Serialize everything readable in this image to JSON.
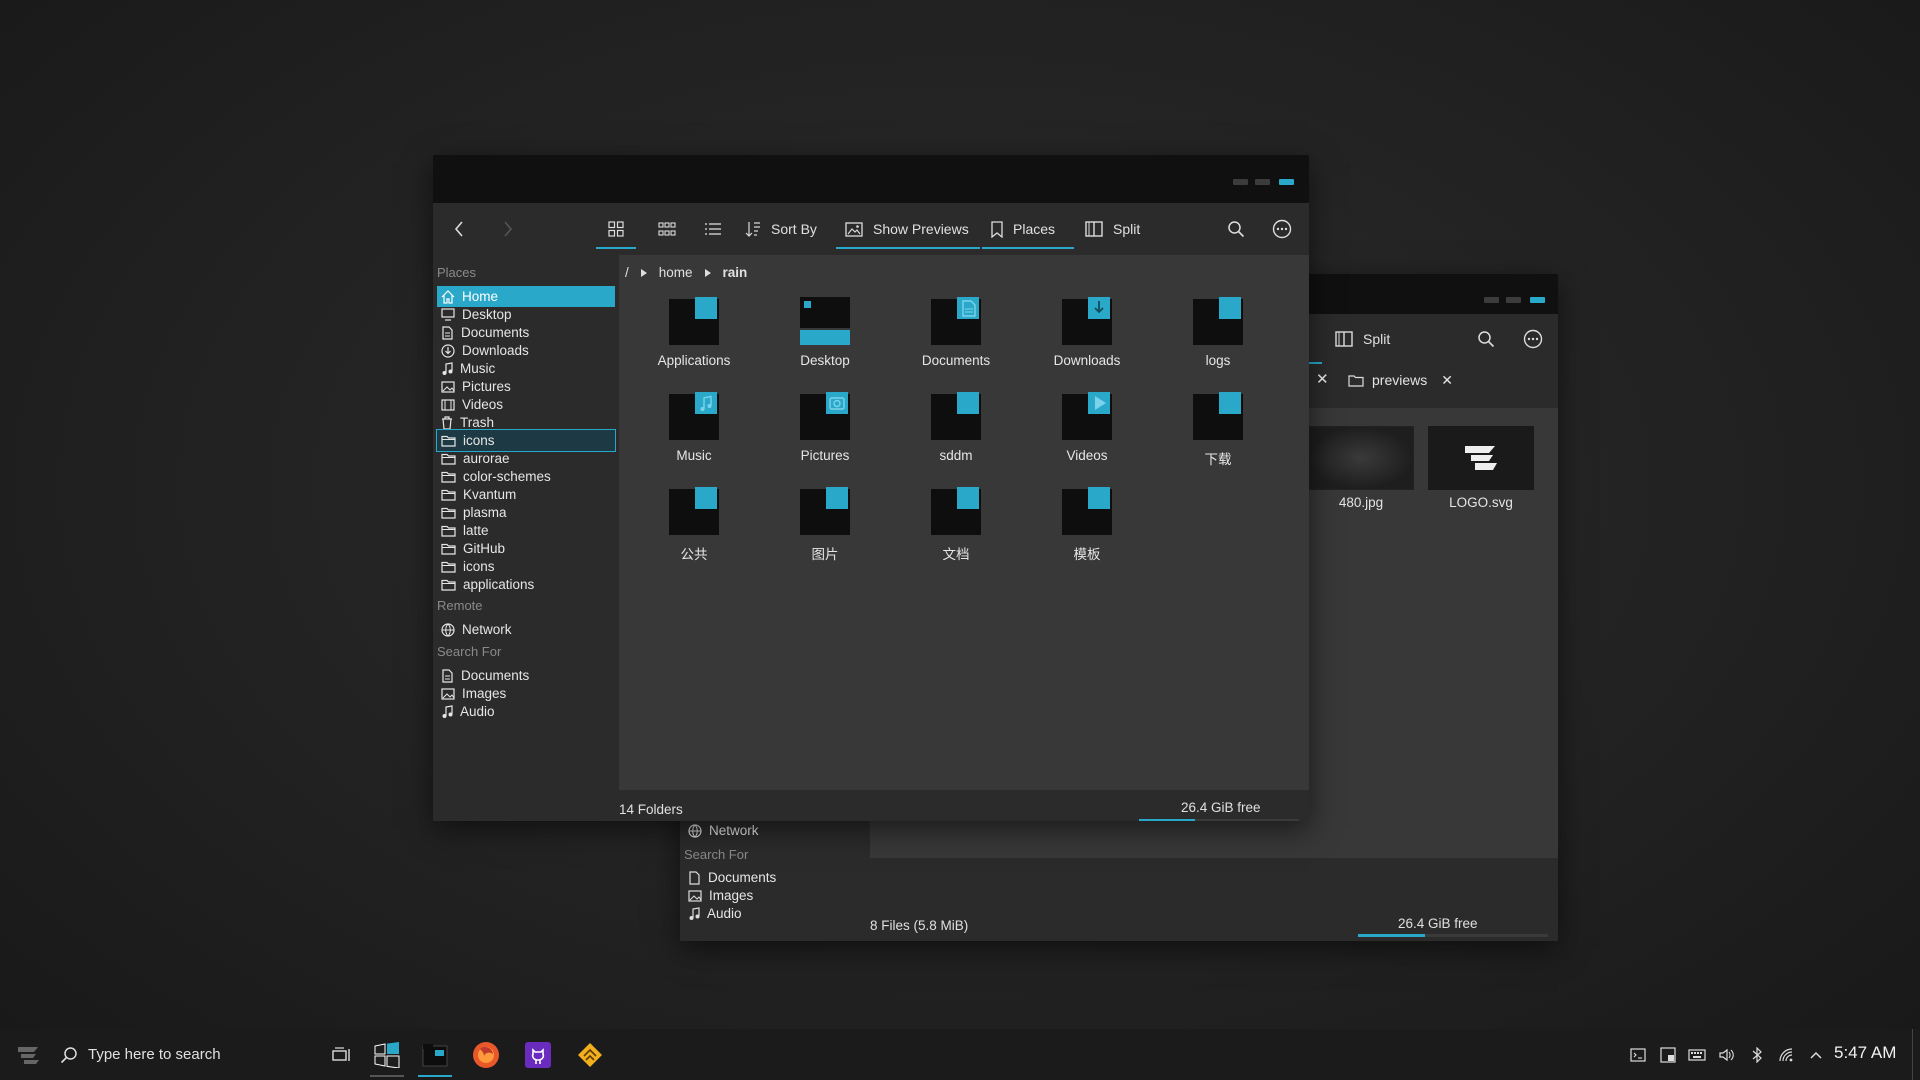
{
  "main_window": {
    "toolbar": {
      "sort_by": "Sort By",
      "show_previews": "Show Previews",
      "places": "Places",
      "split": "Split"
    },
    "sidebar": {
      "places_header": "Places",
      "places": [
        {
          "label": "Home",
          "icon": "home-icon",
          "state": "selected"
        },
        {
          "label": "Desktop",
          "icon": "desktop-icon"
        },
        {
          "label": "Documents",
          "icon": "documents-icon"
        },
        {
          "label": "Downloads",
          "icon": "downloads-icon"
        },
        {
          "label": "Music",
          "icon": "music-icon"
        },
        {
          "label": "Pictures",
          "icon": "pictures-icon"
        },
        {
          "label": "Videos",
          "icon": "videos-icon"
        },
        {
          "label": "Trash",
          "icon": "trash-icon"
        },
        {
          "label": "icons",
          "icon": "folder-icon",
          "state": "highlighted"
        },
        {
          "label": "aurorae",
          "icon": "folder-icon"
        },
        {
          "label": "color-schemes",
          "icon": "folder-icon"
        },
        {
          "label": "Kvantum",
          "icon": "folder-icon"
        },
        {
          "label": "plasma",
          "icon": "folder-icon"
        },
        {
          "label": "latte",
          "icon": "folder-icon"
        },
        {
          "label": "GitHub",
          "icon": "folder-icon"
        },
        {
          "label": "icons",
          "icon": "folder-icon"
        },
        {
          "label": "applications",
          "icon": "folder-icon"
        }
      ],
      "remote_header": "Remote",
      "remote": [
        {
          "label": "Network",
          "icon": "network-icon"
        }
      ],
      "search_header": "Search For",
      "search": [
        {
          "label": "Documents",
          "icon": "documents-icon"
        },
        {
          "label": "Images",
          "icon": "pictures-icon"
        },
        {
          "label": "Audio",
          "icon": "music-icon"
        }
      ]
    },
    "breadcrumb": {
      "root": "/",
      "parts": [
        "home",
        "rain"
      ]
    },
    "folders": [
      {
        "label": "Applications",
        "emblem": "none"
      },
      {
        "label": "Desktop",
        "emblem": "desktop"
      },
      {
        "label": "Documents",
        "emblem": "document"
      },
      {
        "label": "Downloads",
        "emblem": "download"
      },
      {
        "label": "logs",
        "emblem": "none"
      },
      {
        "label": "Music",
        "emblem": "music"
      },
      {
        "label": "Pictures",
        "emblem": "camera"
      },
      {
        "label": "sddm",
        "emblem": "none"
      },
      {
        "label": "Videos",
        "emblem": "play"
      },
      {
        "label": "下载",
        "emblem": "none"
      },
      {
        "label": "公共",
        "emblem": "none"
      },
      {
        "label": "图片",
        "emblem": "none"
      },
      {
        "label": "文档",
        "emblem": "none"
      },
      {
        "label": "模板",
        "emblem": "none"
      }
    ],
    "status": {
      "count": "14 Folders",
      "free": "26.4 GiB free",
      "usage_fraction": 0.35
    }
  },
  "back_window": {
    "toolbar": {
      "split": "Split"
    },
    "tabs": [
      {
        "label": "previews"
      }
    ],
    "files": [
      {
        "label": "480.jpg",
        "kind": "image"
      },
      {
        "label": "LOGO.svg",
        "kind": "logo"
      }
    ],
    "sidebar": {
      "network": "Network",
      "search_header": "Search For",
      "search": [
        "Documents",
        "Images",
        "Audio"
      ]
    },
    "status": {
      "count": "8 Files (5.8 MiB)",
      "free": "26.4 GiB free",
      "usage_fraction": 0.35
    }
  },
  "taskbar": {
    "search_placeholder": "Type here to search",
    "clock": "5:47 AM",
    "apps": [
      "task-view-icon",
      "windows-logo-icon",
      "file-manager-icon",
      "firefox-icon",
      "github-icon",
      "ark-icon"
    ],
    "tray": [
      "terminal-icon",
      "clipboard-icon",
      "keyboard-icon",
      "volume-icon",
      "bluetooth-icon",
      "network-wifi-icon",
      "tray-expand-icon"
    ]
  },
  "colors": {
    "accent": "#2aa8c9",
    "titlebar": "#101010",
    "panel": "#2b2b2b",
    "view": "#383838",
    "taskbar": "#1b1b1b"
  }
}
